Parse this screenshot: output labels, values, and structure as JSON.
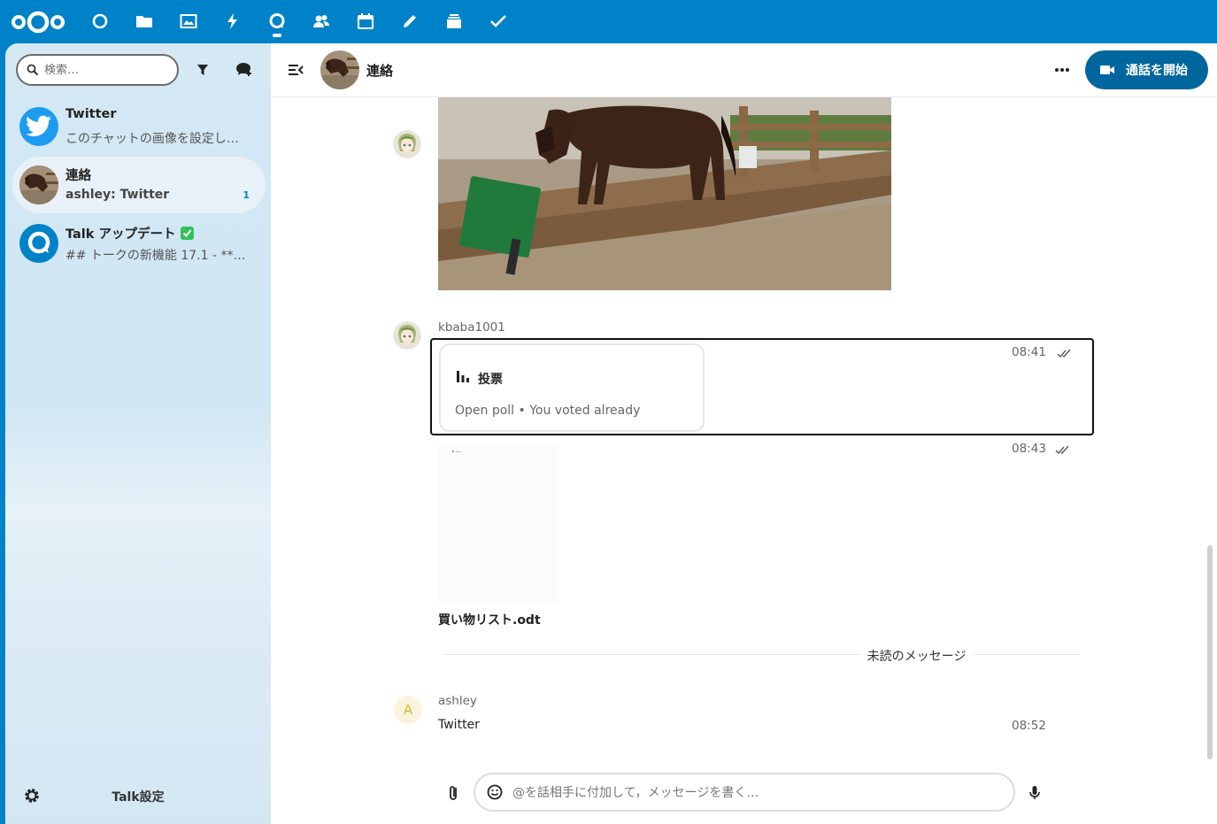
{
  "topbar": {
    "apps": [
      {
        "name": "dashboard-icon"
      },
      {
        "name": "files-icon"
      },
      {
        "name": "photos-icon"
      },
      {
        "name": "activity-icon"
      },
      {
        "name": "talk-icon",
        "active": true
      },
      {
        "name": "contacts-icon"
      },
      {
        "name": "calendar-icon"
      },
      {
        "name": "notes-icon"
      },
      {
        "name": "deck-icon"
      },
      {
        "name": "tasks-icon"
      }
    ]
  },
  "sidebar": {
    "search_placeholder": "検索…",
    "conversations": [
      {
        "title": "Twitter",
        "subtitle": "このチャットの画像を設定し…",
        "avatar": "twitter-icon"
      },
      {
        "title": "連絡",
        "subtitle": "ashley: Twitter",
        "badge": "1",
        "active": true,
        "avatar": "horse-avatar"
      },
      {
        "title": "Talk アップデート",
        "subtitle": "## トークの新機能 17.1 - **Ma…",
        "avatar": "talk-logo-icon"
      }
    ],
    "settings_label": "Talk設定"
  },
  "chat": {
    "title": "連絡",
    "call_button_label": "通話を開始",
    "messages": {
      "poll": {
        "author": "kbaba1001",
        "time": "08:41",
        "poll_title": "投票",
        "poll_status": "Open poll • You voted already"
      },
      "file": {
        "time": "08:43",
        "file_name": "買い物リスト.odt"
      },
      "unread_label": "未読のメッセージ",
      "last": {
        "author": "ashley",
        "avatar_letter": "A",
        "text": "Twitter",
        "time": "08:52"
      }
    },
    "composer_placeholder": "@を話相手に付加して，メッセージを書く…"
  },
  "colors": {
    "brand": "#0082c9",
    "call_button": "#00679e"
  }
}
